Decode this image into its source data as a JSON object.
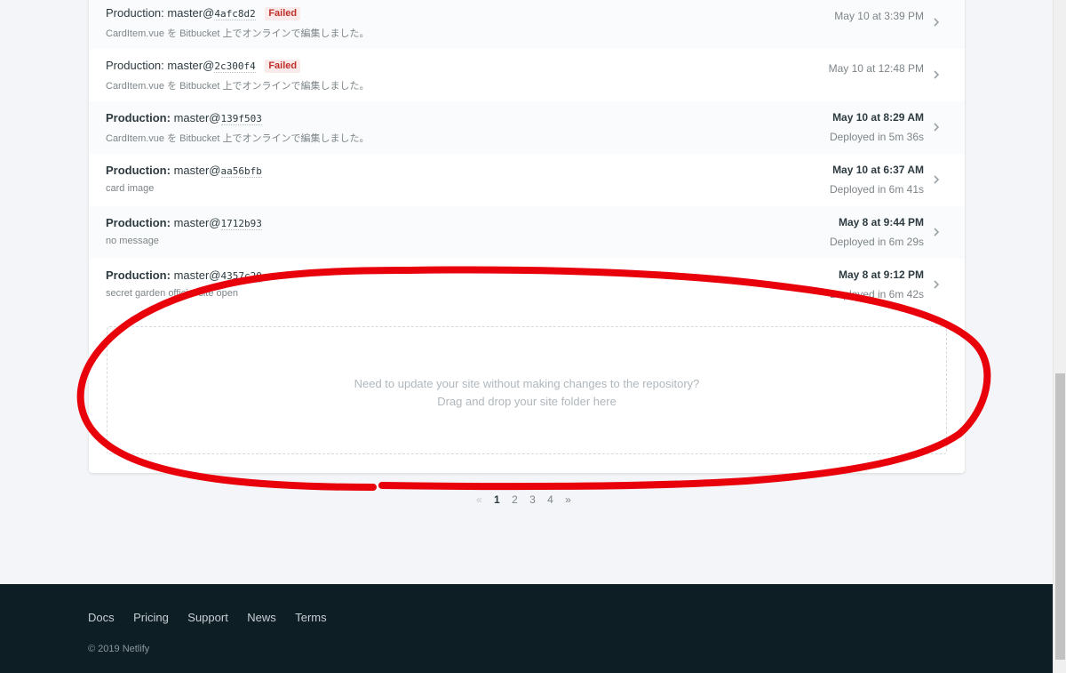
{
  "deploys": [
    {
      "context": "Production:",
      "branch": "master@",
      "sha": "4afc8d2",
      "badge": "Failed",
      "message": "CardItem.vue を Bitbucket 上でオンラインで編集しました。",
      "time": "May 10 at 3:39 PM",
      "duration": "",
      "bold": false
    },
    {
      "context": "Production:",
      "branch": "master@",
      "sha": "2c300f4",
      "badge": "Failed",
      "message": "CardItem.vue を Bitbucket 上でオンラインで編集しました。",
      "time": "May 10 at 12:48 PM",
      "duration": "",
      "bold": false
    },
    {
      "context": "Production:",
      "branch": "master@",
      "sha": "139f503",
      "badge": "",
      "message": "CardItem.vue を Bitbucket 上でオンラインで編集しました。",
      "time": "May 10 at 8:29 AM",
      "duration": "Deployed in 5m 36s",
      "bold": true
    },
    {
      "context": "Production:",
      "branch": "master@",
      "sha": "aa56bfb",
      "badge": "",
      "message": "card image",
      "time": "May 10 at 6:37 AM",
      "duration": "Deployed in 6m 41s",
      "bold": true
    },
    {
      "context": "Production:",
      "branch": "master@",
      "sha": "1712b93",
      "badge": "",
      "message": "no message",
      "time": "May 8 at 9:44 PM",
      "duration": "Deployed in 6m 29s",
      "bold": true
    },
    {
      "context": "Production:",
      "branch": "master@",
      "sha": "4357c20",
      "badge": "",
      "message": "secret garden official site open",
      "time": "May 8 at 9:12 PM",
      "duration": "Deployed in 6m 42s",
      "bold": true
    }
  ],
  "dropzone": {
    "line1": "Need to update your site without making changes to the repository?",
    "line2": "Drag and drop your site folder here"
  },
  "pagination": {
    "prev": "«",
    "pages": [
      "1",
      "2",
      "3",
      "4"
    ],
    "current": "1",
    "next": "»"
  },
  "footer": {
    "links": [
      "Docs",
      "Pricing",
      "Support",
      "News",
      "Terms"
    ],
    "copyright": "© 2019 Netlify"
  },
  "colors": {
    "failed": "#c0302b",
    "annotation": "#e8000b",
    "footer_bg": "#0e1e25"
  }
}
